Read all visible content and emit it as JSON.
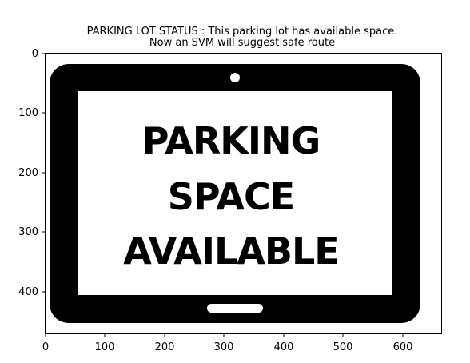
{
  "figure": {
    "title_lines": [
      "PARKING LOT STATUS : This parking lot has available space.",
      "Now an SVM will suggest safe route"
    ],
    "x_ticks": [
      "0",
      "100",
      "200",
      "300",
      "400",
      "500",
      "600"
    ],
    "y_ticks": [
      "0",
      "100",
      "200",
      "300",
      "400"
    ]
  },
  "image_content": {
    "description_icon": "tablet-device-icon",
    "sign_lines": [
      "PARKING",
      "SPACE",
      "AVAILABLE"
    ],
    "colors": {
      "frame": "#000000",
      "screen": "#ffffff"
    }
  }
}
